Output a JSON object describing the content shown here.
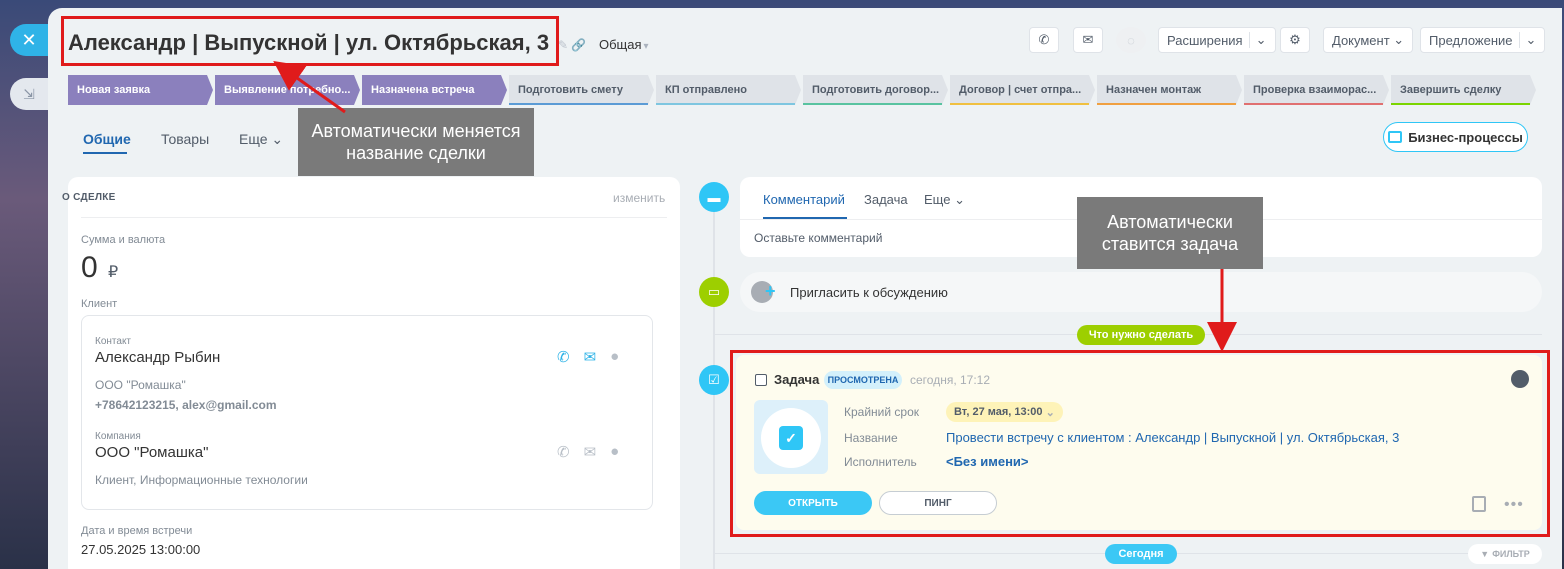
{
  "header": {
    "title": "Александр | Выпускной | ул. Октябрьская, 3",
    "category": "Общая",
    "buttons": {
      "extensions": "Расширения",
      "document": "Документ",
      "proposal": "Предложение"
    }
  },
  "stages": [
    {
      "label": "Новая заявка",
      "state": "done",
      "color": "#8b80bd"
    },
    {
      "label": "Выявление потребно...",
      "state": "done",
      "color": "#8b80bd"
    },
    {
      "label": "Назначена встреча",
      "state": "done",
      "color": "#8b80bd"
    },
    {
      "label": "Подготовить смету",
      "state": "todo",
      "color": "#5b9bd5"
    },
    {
      "label": "КП отправлено",
      "state": "todo",
      "color": "#7ec6e0"
    },
    {
      "label": "Подготовить договор...",
      "state": "todo",
      "color": "#59c3a0"
    },
    {
      "label": "Договор | счет отпра...",
      "state": "todo",
      "color": "#f0c040"
    },
    {
      "label": "Назначен монтаж",
      "state": "todo",
      "color": "#f0a040"
    },
    {
      "label": "Проверка взаиморас...",
      "state": "todo",
      "color": "#e07070"
    },
    {
      "label": "Завершить сделку",
      "state": "todo",
      "color": "#7bd500"
    }
  ],
  "tabs": {
    "general": "Общие",
    "products": "Товары",
    "more": "Еще"
  },
  "business_processes": "Бизнес-процессы",
  "callouts": {
    "title_change": "Автоматически меняется название сделки",
    "task_set": "Автоматически ставится задача"
  },
  "deal": {
    "section_title": "О СДЕЛКЕ",
    "edit": "изменить",
    "amount_label": "Сумма и валюта",
    "amount": "0",
    "currency": "₽",
    "client_label": "Клиент",
    "contact": {
      "label": "Контакт",
      "name": "Александр Рыбин",
      "company": "ООО \"Ромашка\"",
      "details": "+78642123215, alex@gmail.com"
    },
    "company": {
      "label": "Компания",
      "name": "ООО \"Ромашка\"",
      "details": "Клиент, Информационные технологии"
    },
    "meeting_label": "Дата и время встречи",
    "meeting_value": "27.05.2025 13:00:00"
  },
  "timeline": {
    "comment_tabs": {
      "comment": "Комментарий",
      "task": "Задача",
      "more": "Еще"
    },
    "comment_placeholder": "Оставьте комментарий",
    "invite": "Пригласить к обсуждению",
    "todo_pill": "Что нужно сделать",
    "today_pill": "Сегодня",
    "filter": "ФИЛЬТР",
    "task": {
      "title": "Задача",
      "status": "ПРОСМОТРЕНА",
      "time": "сегодня, 17:12",
      "deadline_label": "Крайний срок",
      "deadline_value": "Вт, 27 мая, 13:00",
      "name_label": "Название",
      "name_value": "Провести встречу с клиентом : Александр | Выпускной | ул. Октябрьская, 3",
      "assignee_label": "Исполнитель",
      "assignee_value": "<Без имени>",
      "open": "ОТКРЫТЬ",
      "ping": "ПИНГ"
    }
  }
}
